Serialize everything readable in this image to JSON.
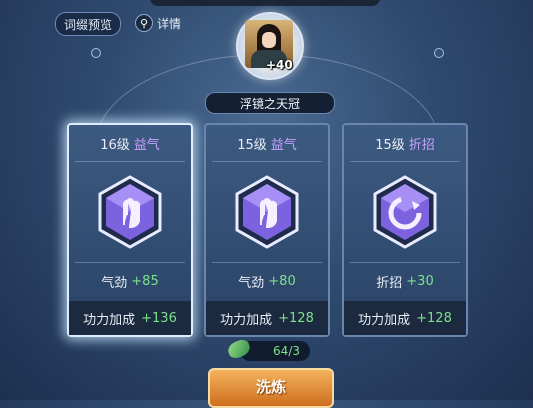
{
  "header": {
    "preview_label": "词缀预览",
    "details_label": "详情"
  },
  "equipment": {
    "name": "浮镜之天冠",
    "bonus": "+40"
  },
  "cards": [
    {
      "level": "16级",
      "attribute": "益气",
      "stat_name": "气劲",
      "stat_value": "+85",
      "power_label": "功力加成",
      "power_value": "+136",
      "selected": true
    },
    {
      "level": "15级",
      "attribute": "益气",
      "stat_name": "气劲",
      "stat_value": "+80",
      "power_label": "功力加成",
      "power_value": "+128",
      "selected": false
    },
    {
      "level": "15级",
      "attribute": "折招",
      "stat_name": "折招",
      "stat_value": "+30",
      "power_label": "功力加成",
      "power_value": "+128",
      "selected": false
    }
  ],
  "material": {
    "count": "64/3"
  },
  "action": {
    "wash_label": "洗炼"
  },
  "colors": {
    "attribute": "#c7a3ff",
    "bonus_green": "#7de08a",
    "button_orange": "#e08a33"
  }
}
